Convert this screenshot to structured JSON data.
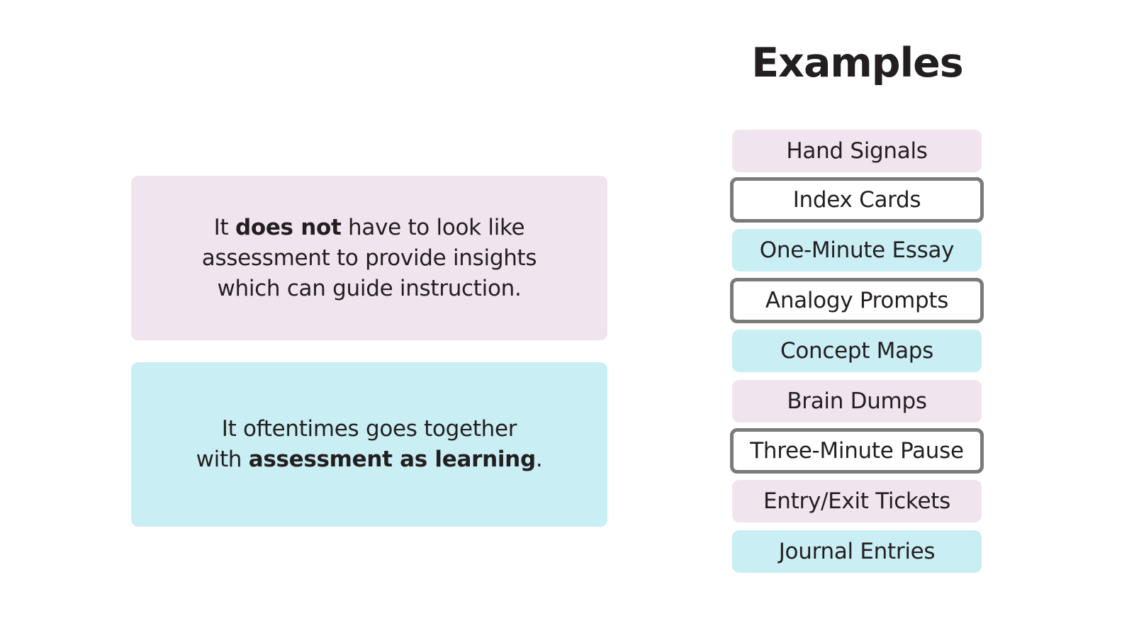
{
  "cards": [
    {
      "style": "pink",
      "lines": [
        [
          {
            "text": "It ",
            "bold": false
          },
          {
            "text": "does not",
            "bold": true
          },
          {
            "text": " have to look like",
            "bold": false
          }
        ],
        [
          {
            "text": "assessment to provide insights",
            "bold": false
          }
        ],
        [
          {
            "text": "which can guide instruction.",
            "bold": false
          }
        ]
      ]
    },
    {
      "style": "cyan",
      "lines": [
        [
          {
            "text": "It oftentimes goes together",
            "bold": false
          }
        ],
        [
          {
            "text": "with ",
            "bold": false
          },
          {
            "text": "assessment as learning",
            "bold": true
          },
          {
            "text": ".",
            "bold": false
          }
        ]
      ]
    }
  ],
  "examples": {
    "title": "Examples",
    "items": [
      {
        "label": "Hand Signals",
        "style": "pink"
      },
      {
        "label": "Index Cards",
        "style": "outline"
      },
      {
        "label": "One-Minute Essay",
        "style": "cyan"
      },
      {
        "label": "Analogy Prompts",
        "style": "outline"
      },
      {
        "label": "Concept Maps",
        "style": "cyan"
      },
      {
        "label": "Brain Dumps",
        "style": "pink"
      },
      {
        "label": "Three-Minute Pause",
        "style": "outline"
      },
      {
        "label": "Entry/Exit Tickets",
        "style": "pink"
      },
      {
        "label": "Journal Entries",
        "style": "cyan"
      }
    ]
  },
  "colors": {
    "pink": "#f0e4ef",
    "cyan": "#c9eef4",
    "outline_border": "#7a7a7a",
    "text": "#231f20"
  }
}
